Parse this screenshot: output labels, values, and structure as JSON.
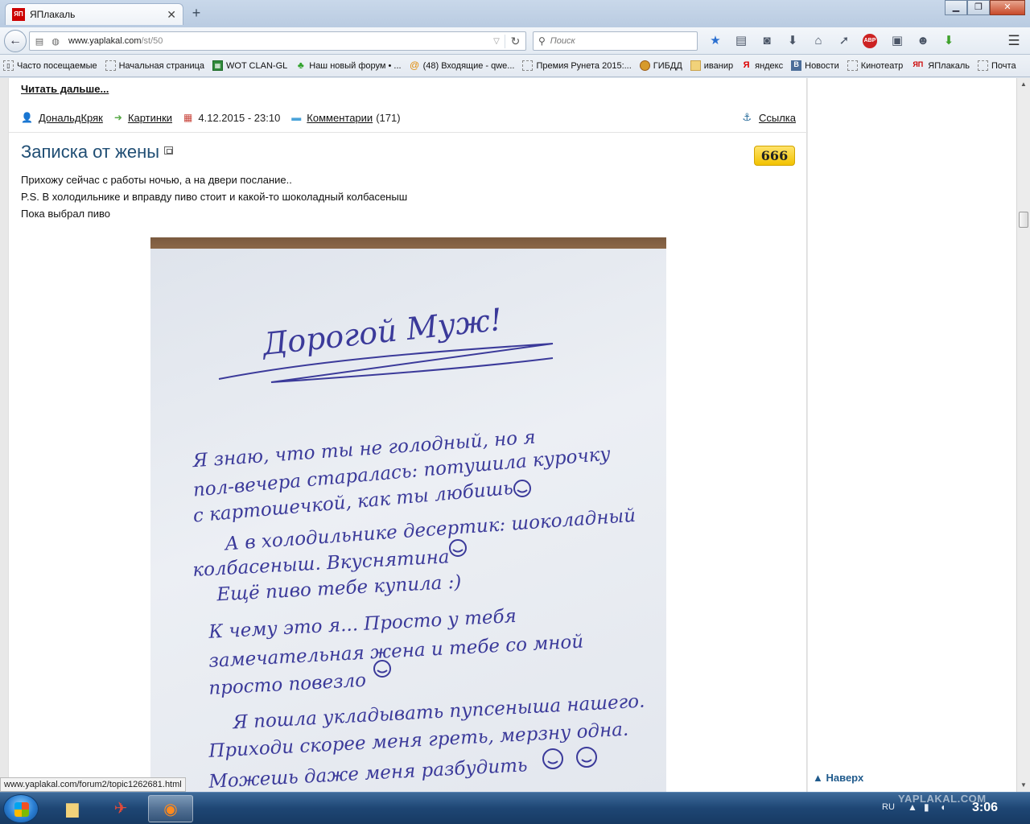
{
  "browser": {
    "tab_title": "ЯПлакаль",
    "tab_favicon_text": "ЯП",
    "url_host": "www.yaplakal.com",
    "url_path": "/st/50",
    "search_placeholder": "Поиск",
    "status_url": "www.yaplakal.com/forum2/topic1262681.html"
  },
  "bookmarks": [
    {
      "label": "Часто посещаемые",
      "icon": "book-icon"
    },
    {
      "label": "Начальная страница",
      "icon": "page-icon"
    },
    {
      "label": "WOT CLAN-GL",
      "icon": "sheet-icon"
    },
    {
      "label": "Наш новый форум • ...",
      "icon": "clover-icon"
    },
    {
      "label": "(48) Входящие - qwe...",
      "icon": "mail-icon"
    },
    {
      "label": "Премия Рунета 2015:...",
      "icon": "page-icon"
    },
    {
      "label": "ГИБДД",
      "icon": "gibdd-icon"
    },
    {
      "label": "иванир",
      "icon": "folder-icon"
    },
    {
      "label": "яндекс",
      "icon": "yandex-icon"
    },
    {
      "label": "Новости",
      "icon": "vk-icon"
    },
    {
      "label": "Кинотеатр",
      "icon": "page-icon"
    },
    {
      "label": "ЯПлакаль",
      "icon": "yap-icon"
    },
    {
      "label": "Почта",
      "icon": "page-icon"
    }
  ],
  "page": {
    "read_more": "Читать дальше...",
    "meta": {
      "author": "ДональдКряк",
      "category": "Картинки",
      "date": "4.12.2015 - 23:10",
      "comments_label": "Комментарии",
      "comments_count": "(171)",
      "link_label": "Ссылка"
    },
    "post": {
      "title": "Записка от жены",
      "rating": "666",
      "lines": [
        "Прихожу сейчас с работы ночью, а на двери послание..",
        "P.S. В холодильнике и вправду пиво стоит и какой-то шоколадный колбасеныш",
        "Пока выбрал пиво"
      ]
    },
    "note": {
      "heading": "Дорогой Муж!",
      "lines": [
        "Я знаю, что ты не голодный, но я",
        "пол-вечера старалась: потушила курочку",
        "с картошечкой, как ты любишь",
        "А в холодильнике десертик: шоколадный",
        "колбасеныш. Вкуснятина",
        "Ещё пиво тебе купила :)",
        "К чему это я... Просто у тебя",
        "замечательная жена и тебе со мной",
        "просто повезло",
        "Я пошла укладывать пупсеныша нашего.",
        "Приходи скорее меня греть, мерзну одна.",
        "Можешь даже меня разбудить"
      ]
    },
    "back_to_top": "Наверх"
  },
  "taskbar": {
    "lang": "RU",
    "clock": "3:06",
    "watermark": "YAPLAKAL.COM"
  }
}
